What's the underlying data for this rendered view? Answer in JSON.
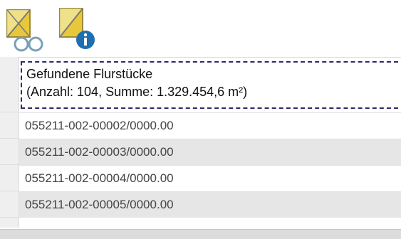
{
  "toolbar": {
    "tools": [
      {
        "icon": "parcel-select-glasses-icon"
      },
      {
        "icon": "parcel-info-icon"
      }
    ]
  },
  "results": {
    "header_line1": "Gefundene Flurstücke",
    "header_line2": "(Anzahl: 104, Summe: 1.329.454,6 m²)",
    "rows": [
      "055211-002-00002/0000.00",
      "055211-002-00003/0000.00",
      "055211-002-00004/0000.00",
      "055211-002-00005/0000.00"
    ]
  },
  "colors": {
    "icon_yellow": "#e8c83a",
    "info_blue": "#1f6fb0",
    "header_border": "#2a2a6b",
    "row_alt": "#e6e6e6"
  }
}
